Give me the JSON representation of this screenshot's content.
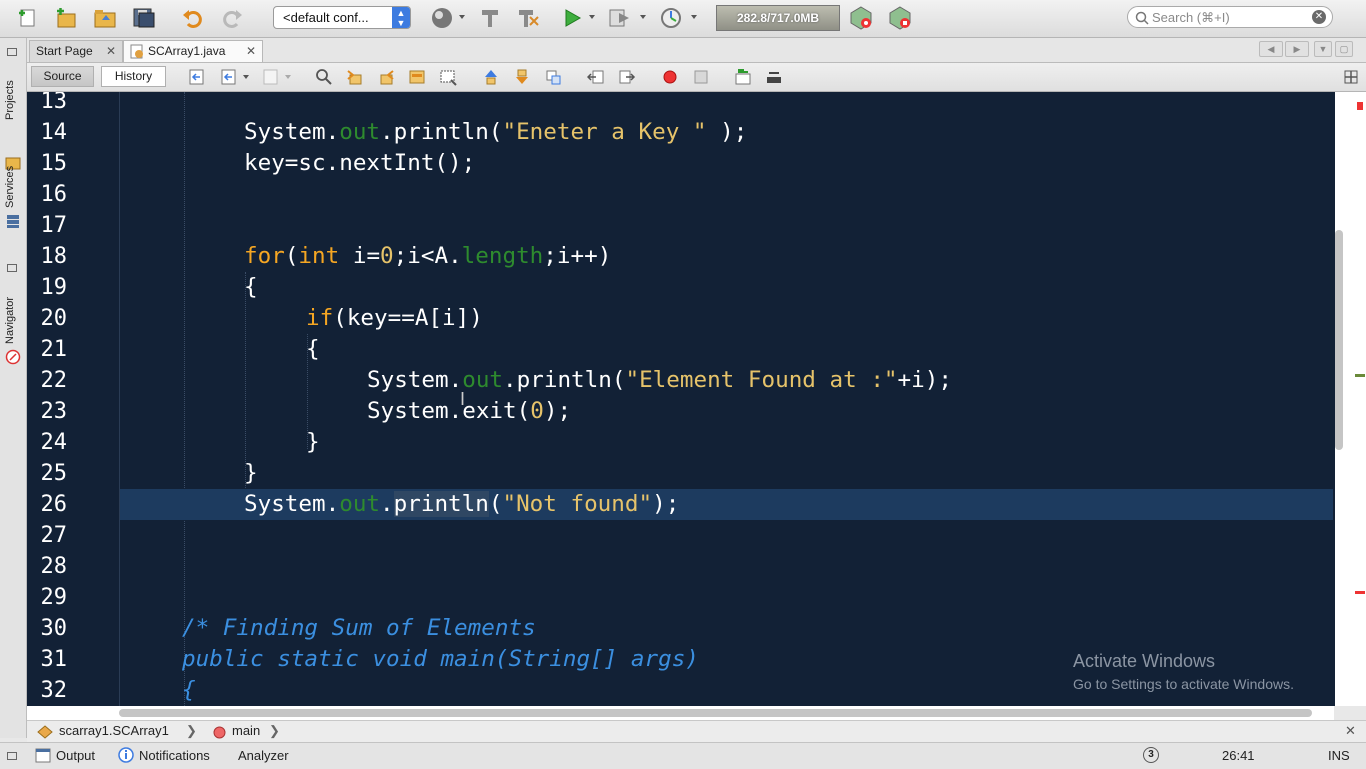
{
  "toolbar": {
    "config": "<default conf...",
    "memory": "282.8/717.0MB",
    "search_placeholder": "Search (⌘+I)",
    "icons": [
      "new-file-icon",
      "new-project-icon",
      "open-project-icon",
      "save-all-icon",
      "undo-icon",
      "redo-icon",
      "globe-icon",
      "build-icon",
      "clean-build-icon",
      "run-icon",
      "debug-icon",
      "profile-icon",
      "gc-icon",
      "profiler-calibrate-icon"
    ]
  },
  "sidebar": {
    "projects": "Projects",
    "services": "Services",
    "navigator": "Navigator"
  },
  "tabs": [
    {
      "label": "Start Page",
      "close": "✕"
    },
    {
      "label": "SCArray1.java",
      "close": "✕"
    }
  ],
  "editor_toolbar": {
    "source": "Source",
    "history": "History"
  },
  "editor": {
    "line_numbers": [
      "13",
      "14",
      "15",
      "16",
      "17",
      "18",
      "19",
      "20",
      "21",
      "22",
      "23",
      "24",
      "25",
      "26",
      "27",
      "28",
      "29",
      "30",
      "31",
      "32"
    ]
  },
  "code": {
    "l14": {
      "a": "System.",
      "b": "out",
      "c": ".println(",
      "d": "\"Eneter a Key \"",
      "e": " );"
    },
    "l15": {
      "a": "key=sc.nextInt();"
    },
    "l18": {
      "a": "for",
      "b": "(",
      "c": "int",
      "d": " i=",
      "e": "0",
      "f": ";i<A.",
      "g": "length",
      "h": ";i++)"
    },
    "l19": {
      "a": "{"
    },
    "l20": {
      "a": "if",
      "b": "(key==A[i])"
    },
    "l21": {
      "a": "{"
    },
    "l22": {
      "a": "System.",
      "b": "out",
      "c": ".println(",
      "d": "\"Element Found at :\"",
      "e": "+i);"
    },
    "l23": {
      "a": "System.exit(",
      "b": "0",
      "c": ");"
    },
    "l24": {
      "a": "}"
    },
    "l25": {
      "a": "}"
    },
    "l26": {
      "a": "System.",
      "b": "out",
      "c": ".",
      "d": "println",
      "e": "(",
      "f": "\"Not found\"",
      "g": ");"
    },
    "l30": {
      "a": "/* Finding Sum of Elements"
    },
    "l31": {
      "a": "public static void main(String[] args)"
    },
    "l32": {
      "a": "{"
    }
  },
  "watermark": {
    "title": "Activate Windows",
    "subtitle": "Go to Settings to activate Windows."
  },
  "breadcrumb": {
    "class": "scarray1.SCArray1",
    "method": "main",
    "close": "✕"
  },
  "statusbar": {
    "output": "Output",
    "notifications": "Notifications",
    "analyzer": "Analyzer",
    "badge": "3",
    "position": "26:41",
    "mode": "INS"
  }
}
